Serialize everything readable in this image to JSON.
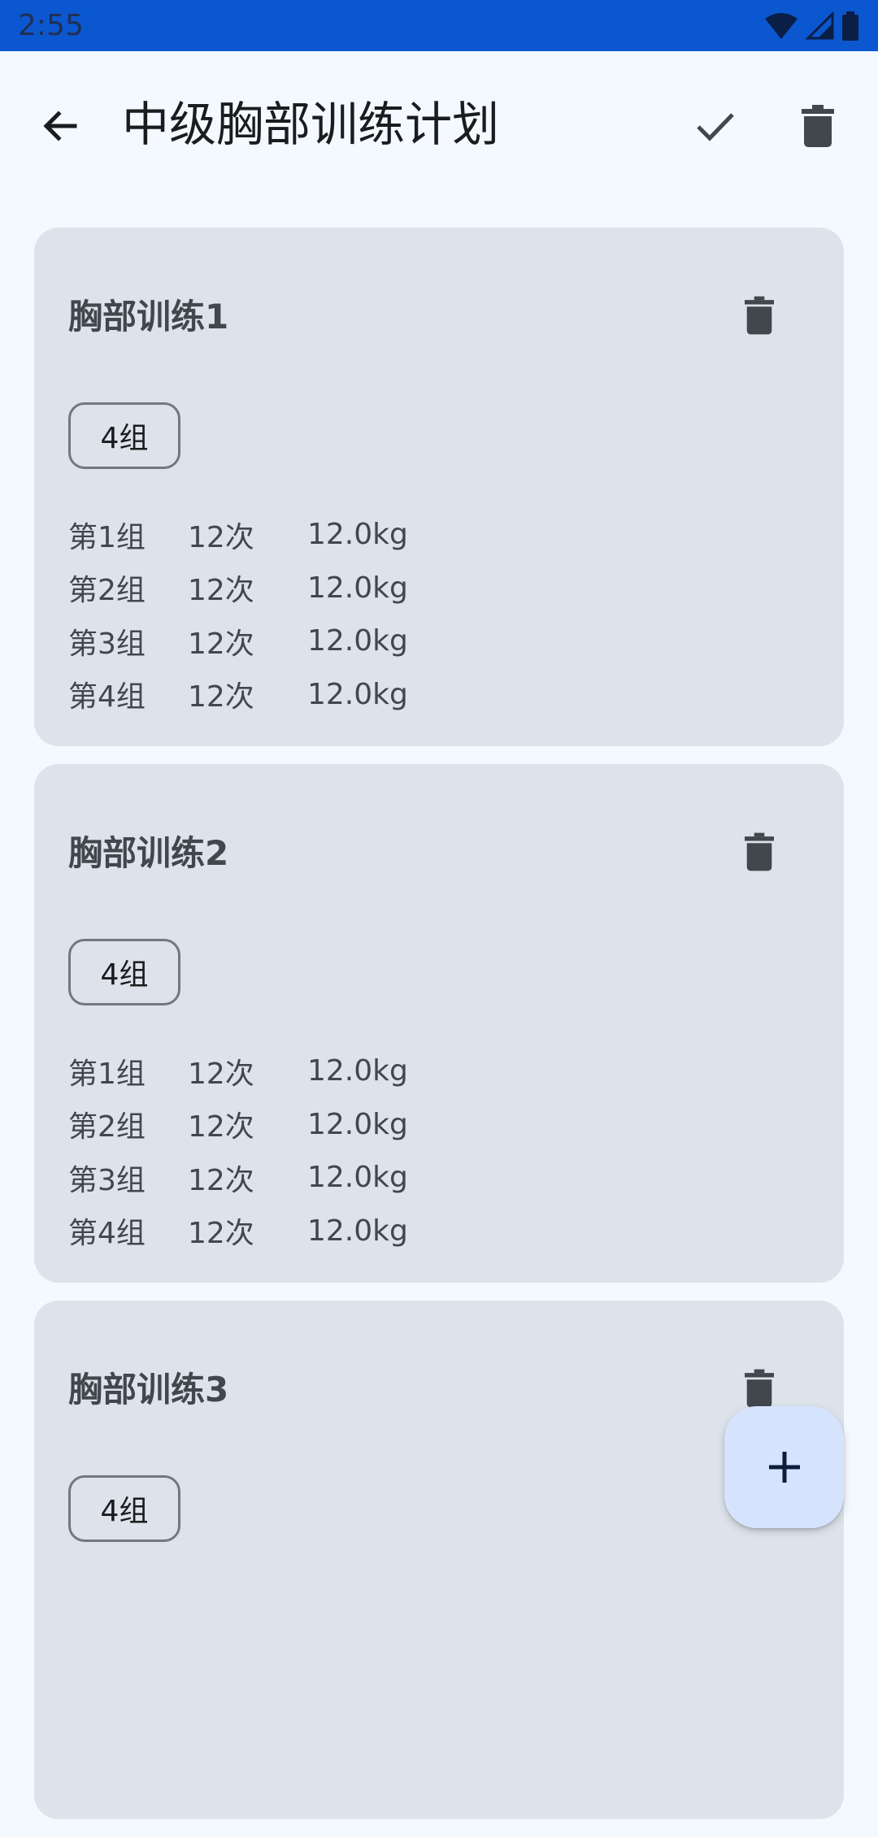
{
  "status_bar": {
    "time": "2:55",
    "icons": [
      "wifi-icon",
      "signal-icon",
      "battery-icon"
    ]
  },
  "app_bar": {
    "title": "中级胸部训练计划",
    "back_icon": "arrow-back-icon",
    "confirm_icon": "check-icon",
    "delete_icon": "trash-icon"
  },
  "colors": {
    "status_bar": "#0b57cf",
    "background": "#f4f9ff",
    "card": "#dee3eb",
    "fab": "#d6e3fd",
    "icon": "#42474e"
  },
  "exercises": [
    {
      "name": "胸部训练1",
      "sets_label": "4组",
      "sets": [
        {
          "label": "第1组",
          "reps": "12次",
          "weight": "12.0kg"
        },
        {
          "label": "第2组",
          "reps": "12次",
          "weight": "12.0kg"
        },
        {
          "label": "第3组",
          "reps": "12次",
          "weight": "12.0kg"
        },
        {
          "label": "第4组",
          "reps": "12次",
          "weight": "12.0kg"
        }
      ]
    },
    {
      "name": "胸部训练2",
      "sets_label": "4组",
      "sets": [
        {
          "label": "第1组",
          "reps": "12次",
          "weight": "12.0kg"
        },
        {
          "label": "第2组",
          "reps": "12次",
          "weight": "12.0kg"
        },
        {
          "label": "第3组",
          "reps": "12次",
          "weight": "12.0kg"
        },
        {
          "label": "第4组",
          "reps": "12次",
          "weight": "12.0kg"
        }
      ]
    },
    {
      "name": "胸部训练3",
      "sets_label": "4组",
      "sets": []
    }
  ],
  "fab": {
    "icon": "plus-icon"
  }
}
